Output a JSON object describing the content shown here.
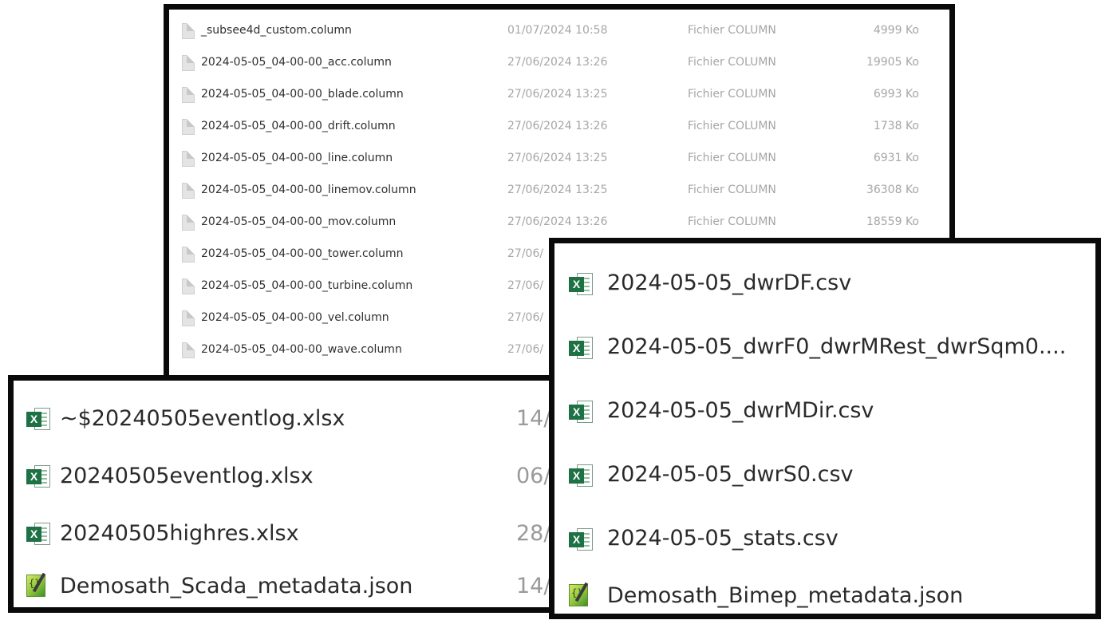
{
  "column_panel": {
    "rows": [
      {
        "name": "_subsee4d_custom.column",
        "date": "01/07/2024 10:58",
        "type": "Fichier COLUMN",
        "size": "4999 Ko"
      },
      {
        "name": "2024-05-05_04-00-00_acc.column",
        "date": "27/06/2024 13:26",
        "type": "Fichier COLUMN",
        "size": "19905 Ko"
      },
      {
        "name": "2024-05-05_04-00-00_blade.column",
        "date": "27/06/2024 13:25",
        "type": "Fichier COLUMN",
        "size": "6993 Ko"
      },
      {
        "name": "2024-05-05_04-00-00_drift.column",
        "date": "27/06/2024 13:26",
        "type": "Fichier COLUMN",
        "size": "1738 Ko"
      },
      {
        "name": "2024-05-05_04-00-00_line.column",
        "date": "27/06/2024 13:25",
        "type": "Fichier COLUMN",
        "size": "6931 Ko"
      },
      {
        "name": "2024-05-05_04-00-00_linemov.column",
        "date": "27/06/2024 13:25",
        "type": "Fichier COLUMN",
        "size": "36308 Ko"
      },
      {
        "name": "2024-05-05_04-00-00_mov.column",
        "date": "27/06/2024 13:26",
        "type": "Fichier COLUMN",
        "size": "18559 Ko"
      },
      {
        "name": "2024-05-05_04-00-00_tower.column",
        "date": "27/06/",
        "type": "",
        "size": ""
      },
      {
        "name": "2024-05-05_04-00-00_turbine.column",
        "date": "27/06/",
        "type": "",
        "size": ""
      },
      {
        "name": "2024-05-05_04-00-00_vel.column",
        "date": "27/06/",
        "type": "",
        "size": ""
      },
      {
        "name": "2024-05-05_04-00-00_wave.column",
        "date": "27/06/",
        "type": "",
        "size": ""
      }
    ]
  },
  "left_panel": {
    "rows": [
      {
        "name": "~$20240505eventlog.xlsx",
        "date": "14/",
        "icon": "excel-icon"
      },
      {
        "name": "20240505eventlog.xlsx",
        "date": "06/",
        "icon": "excel-icon"
      },
      {
        "name": "20240505highres.xlsx",
        "date": "28/",
        "icon": "excel-icon"
      },
      {
        "name": "Demosath_Scada_metadata.json",
        "date": "14/",
        "icon": "json-icon"
      }
    ]
  },
  "right_panel": {
    "rows": [
      {
        "name": "2024-05-05_dwrDF.csv",
        "icon": "excel-icon"
      },
      {
        "name": "2024-05-05_dwrF0_dwrMRest_dwrSqm0....",
        "icon": "excel-icon"
      },
      {
        "name": "2024-05-05_dwrMDir.csv",
        "icon": "excel-icon"
      },
      {
        "name": "2024-05-05_dwrS0.csv",
        "icon": "excel-icon"
      },
      {
        "name": "2024-05-05_stats.csv",
        "icon": "excel-icon"
      },
      {
        "name": "Demosath_Bimep_metadata.json",
        "icon": "json-icon"
      }
    ]
  },
  "icons": {
    "excel_badge": "X",
    "json_glyph": "{}"
  },
  "colors": {
    "excel_green": "#1e7145",
    "frame_black": "#0a0a0a"
  }
}
